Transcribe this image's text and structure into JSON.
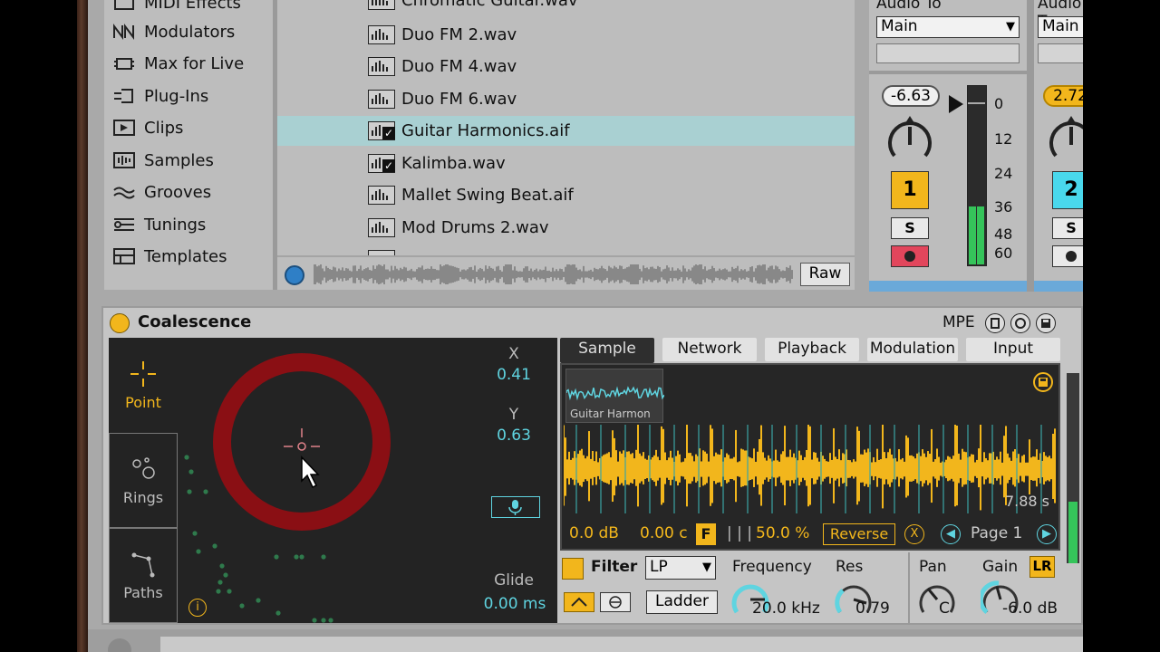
{
  "sidebar": {
    "items": [
      {
        "label": "MIDI Effects",
        "icon": "midi-effects-icon"
      },
      {
        "label": "Modulators",
        "icon": "modulators-icon"
      },
      {
        "label": "Max for Live",
        "icon": "max-for-live-icon"
      },
      {
        "label": "Plug-Ins",
        "icon": "plugins-icon"
      },
      {
        "label": "Clips",
        "icon": "clips-icon"
      },
      {
        "label": "Samples",
        "icon": "samples-icon"
      },
      {
        "label": "Grooves",
        "icon": "grooves-icon"
      },
      {
        "label": "Tunings",
        "icon": "tunings-icon"
      },
      {
        "label": "Templates",
        "icon": "templates-icon"
      }
    ]
  },
  "files": {
    "items": [
      {
        "name": "Chromatic Guitar.wav",
        "selected": false,
        "checked": false
      },
      {
        "name": "Duo FM 2.wav",
        "selected": false,
        "checked": false
      },
      {
        "name": "Duo FM 4.wav",
        "selected": false,
        "checked": false
      },
      {
        "name": "Duo FM 6.wav",
        "selected": false,
        "checked": false
      },
      {
        "name": "Guitar Harmonics.aif",
        "selected": true,
        "checked": true
      },
      {
        "name": "Kalimba.wav",
        "selected": false,
        "checked": true
      },
      {
        "name": "Mallet Swing Beat.aif",
        "selected": false,
        "checked": false
      },
      {
        "name": "Mod Drums 2.wav",
        "selected": false,
        "checked": false
      }
    ],
    "raw_label": "Raw"
  },
  "mixer": {
    "audio_to_label": "Audio To",
    "route_value": "Main",
    "track1": {
      "volume": "-6.63",
      "number": "1",
      "solo": "S",
      "color": "#f2b61c"
    },
    "track2": {
      "volume": "2.72",
      "number": "2",
      "solo": "S",
      "color": "#49d8ec"
    },
    "db_ticks": [
      "0",
      "12",
      "24",
      "36",
      "48",
      "60"
    ],
    "meter_level": 0.32
  },
  "device": {
    "title": "Coalescence",
    "mpe_label": "MPE",
    "modes": [
      {
        "label": "Point",
        "icon": "crosshair-icon"
      },
      {
        "label": "Rings",
        "icon": "rings-icon"
      },
      {
        "label": "Paths",
        "icon": "paths-icon"
      }
    ],
    "x_label": "X",
    "x_value": "0.41",
    "y_label": "Y",
    "y_value": "0.63",
    "glide_label": "Glide",
    "glide_value": "0.00 ms",
    "info_label": "i",
    "tabs": [
      "Sample",
      "Network",
      "Playback",
      "Modulation",
      "Input"
    ],
    "active_tab": "Sample",
    "sample_name": "Guitar Harmon",
    "duration": "7.88 s",
    "gain_db": "0.0 dB",
    "detune": "0.00 c",
    "f_label": "F",
    "bars_glyph": "| | |",
    "percent": "50.0 %",
    "reverse_label": "Reverse",
    "page_label": "Page 1",
    "filter_label": "Filter",
    "filter_type": "LP",
    "ladder_label": "Ladder",
    "frequency_label": "Frequency",
    "frequency_value": "20.0 kHz",
    "res_label": "Res",
    "res_value": "0.79",
    "pan_label": "Pan",
    "pan_value": "C",
    "gain_label": "Gain",
    "gain_value": "-6.0 dB",
    "lr_label": "LR",
    "colors": {
      "accent": "#f2b61c",
      "cyan": "#5fd4e0",
      "ring": "#8a0f14",
      "wave": "#f2b61c"
    }
  }
}
